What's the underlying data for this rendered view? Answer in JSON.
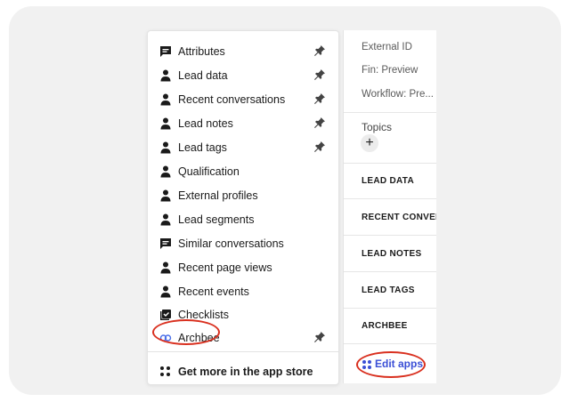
{
  "menu": {
    "items": [
      {
        "label": "Attributes",
        "icon": "message-icon",
        "pinned": true
      },
      {
        "label": "Lead data",
        "icon": "person-icon",
        "pinned": true
      },
      {
        "label": "Recent conversations",
        "icon": "person-icon",
        "pinned": true
      },
      {
        "label": "Lead notes",
        "icon": "person-icon",
        "pinned": true
      },
      {
        "label": "Lead tags",
        "icon": "person-icon",
        "pinned": true
      },
      {
        "label": "Qualification",
        "icon": "person-icon",
        "pinned": false
      },
      {
        "label": "External profiles",
        "icon": "person-icon",
        "pinned": false
      },
      {
        "label": "Lead segments",
        "icon": "person-icon",
        "pinned": false
      },
      {
        "label": "Similar conversations",
        "icon": "message-icon",
        "pinned": false
      },
      {
        "label": "Recent page views",
        "icon": "person-icon",
        "pinned": false
      },
      {
        "label": "Recent events",
        "icon": "person-icon",
        "pinned": false
      },
      {
        "label": "Checklists",
        "icon": "checklist-icon",
        "pinned": false
      },
      {
        "label": "Archbee",
        "icon": "link-icon",
        "pinned": true
      }
    ],
    "store_label": "Get more in the app store"
  },
  "panel": {
    "attributes": [
      "External ID",
      "Fin: Preview",
      "Workflow: Pre..."
    ],
    "topics_label": "Topics",
    "add_symbol": "+",
    "sections": [
      "LEAD DATA",
      "RECENT CONVER",
      "LEAD NOTES",
      "LEAD TAGS",
      "ARCHBEE"
    ],
    "edit_apps_label": "Edit apps"
  },
  "colors": {
    "highlight_ring": "#d9301f",
    "edit_apps": "#3b4fd6",
    "archbee_icon": "#4a6fe8"
  }
}
